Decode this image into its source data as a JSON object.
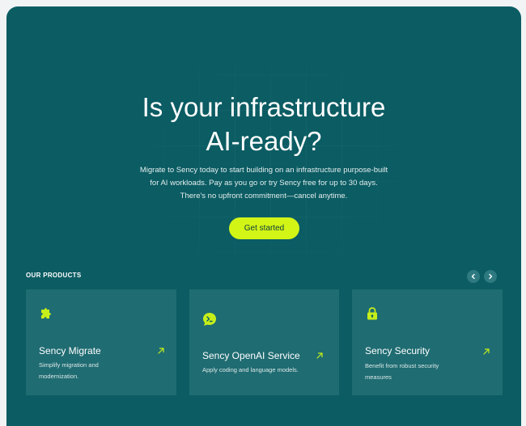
{
  "hero": {
    "title_line1": "Is your infrastructure",
    "title_line2": "AI-ready?",
    "description": "Migrate to Sency today to start building on an infrastructure purpose-built for AI workloads. Pay as you go or try Sency free for up to 30 days. There's no upfront commitment—cancel anytime.",
    "cta_label": "Get started"
  },
  "products": {
    "section_label": "OUR PRODUCTS",
    "items": [
      {
        "title": "Sency Migrate",
        "description": "Simplify migration and modernization.",
        "icon": "puzzle-icon"
      },
      {
        "title": "Sency OpenAI Service",
        "description": "Apply coding and language models.",
        "icon": "ai-code-icon"
      },
      {
        "title": "Sency Security",
        "description": "Benefit from robust security measures",
        "icon": "lock-icon"
      }
    ]
  },
  "colors": {
    "panel_bg": "#0b5c63",
    "card_bg": "#1f6c72",
    "accent": "#d2f516",
    "page_bg": "#f1f3f4"
  }
}
